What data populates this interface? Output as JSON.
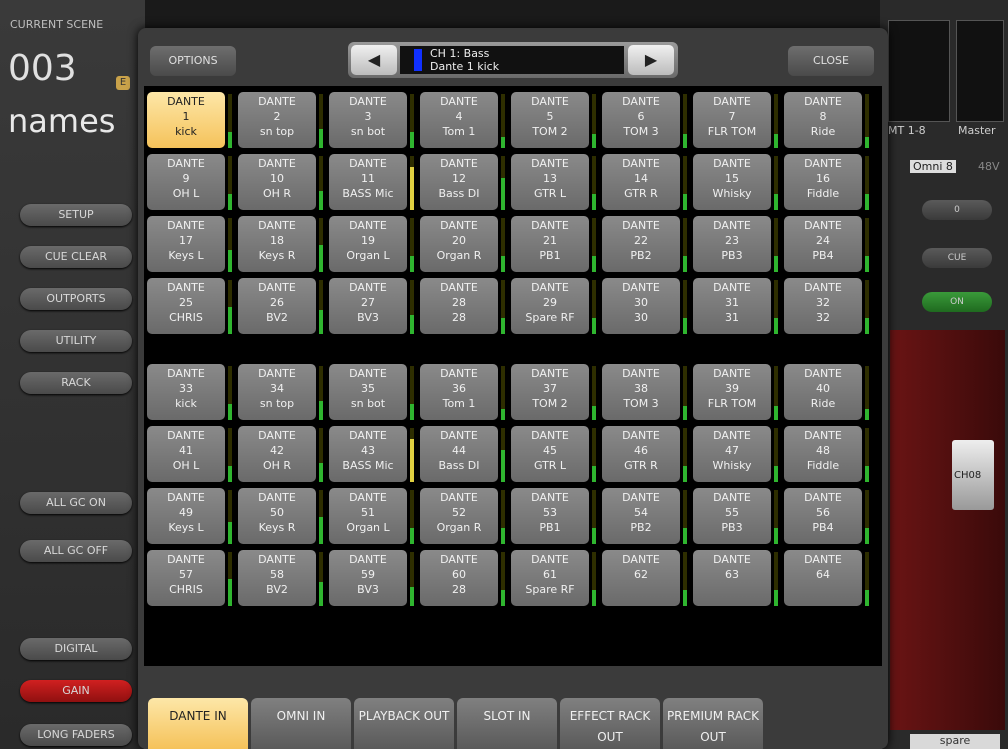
{
  "scene": {
    "label": "CURRENT SCENE",
    "number": "003",
    "edit_badge": "E",
    "name": "names"
  },
  "left_buttons": {
    "setup": "SETUP",
    "cue_clear": "CUE CLEAR",
    "outports": "OUTPORTS",
    "utility": "UTILITY",
    "rack": "RACK",
    "all_gc_on": "ALL GC ON",
    "all_gc_off": "ALL GC OFF",
    "digital": "DIGITAL",
    "gain": "GAIN",
    "long_faders": "LONG FADERS"
  },
  "right_panel": {
    "mt_label": "MT 1-8",
    "master_label": "Master",
    "omni_label": "Omni 8",
    "v48_label": "48V",
    "zero_btn": "0",
    "cue_btn": "CUE",
    "on_btn": "ON",
    "fader_label": "CH08",
    "spare_label": "spare"
  },
  "dialog": {
    "options": "OPTIONS",
    "close": "CLOSE",
    "prev_arrow": "◀",
    "next_arrow": "▶",
    "selector_line1": "CH 1: Bass",
    "selector_line2": "Dante 1 kick",
    "selector_color": "#1030ff",
    "ports": [
      {
        "type": "DANTE",
        "num": "1",
        "name": "kick",
        "selected": true,
        "level": 0.3
      },
      {
        "type": "DANTE",
        "num": "2",
        "name": "sn top",
        "level": 0.35
      },
      {
        "type": "DANTE",
        "num": "3",
        "name": "sn bot",
        "level": 0.3
      },
      {
        "type": "DANTE",
        "num": "4",
        "name": "Tom 1",
        "level": 0.2
      },
      {
        "type": "DANTE",
        "num": "5",
        "name": "TOM 2",
        "level": 0.25
      },
      {
        "type": "DANTE",
        "num": "6",
        "name": "TOM 3",
        "level": 0.25
      },
      {
        "type": "DANTE",
        "num": "7",
        "name": "FLR TOM",
        "level": 0.25
      },
      {
        "type": "DANTE",
        "num": "8",
        "name": "Ride",
        "level": 0.2
      },
      {
        "type": "DANTE",
        "num": "9",
        "name": "OH L",
        "level": 0.3
      },
      {
        "type": "DANTE",
        "num": "10",
        "name": "OH R",
        "level": 0.35
      },
      {
        "type": "DANTE",
        "num": "11",
        "name": "BASS Mic",
        "level": 0.8
      },
      {
        "type": "DANTE",
        "num": "12",
        "name": "Bass DI",
        "level": 0.6
      },
      {
        "type": "DANTE",
        "num": "13",
        "name": "GTR L",
        "level": 0.3
      },
      {
        "type": "DANTE",
        "num": "14",
        "name": "GTR R",
        "level": 0.3
      },
      {
        "type": "DANTE",
        "num": "15",
        "name": "Whisky",
        "level": 0.3
      },
      {
        "type": "DANTE",
        "num": "16",
        "name": "Fiddle",
        "level": 0.3
      },
      {
        "type": "DANTE",
        "num": "17",
        "name": "Keys L",
        "level": 0.4
      },
      {
        "type": "DANTE",
        "num": "18",
        "name": "Keys R",
        "level": 0.5
      },
      {
        "type": "DANTE",
        "num": "19",
        "name": "Organ L",
        "level": 0.3
      },
      {
        "type": "DANTE",
        "num": "20",
        "name": "Organ R",
        "level": 0.3
      },
      {
        "type": "DANTE",
        "num": "21",
        "name": "PB1",
        "level": 0.3
      },
      {
        "type": "DANTE",
        "num": "22",
        "name": "PB2",
        "level": 0.3
      },
      {
        "type": "DANTE",
        "num": "23",
        "name": "PB3",
        "level": 0.3
      },
      {
        "type": "DANTE",
        "num": "24",
        "name": "PB4",
        "level": 0.3
      },
      {
        "type": "DANTE",
        "num": "25",
        "name": "CHRIS",
        "level": 0.5
      },
      {
        "type": "DANTE",
        "num": "26",
        "name": "BV2",
        "level": 0.45
      },
      {
        "type": "DANTE",
        "num": "27",
        "name": "BV3",
        "level": 0.35
      },
      {
        "type": "DANTE",
        "num": "28",
        "name": "28",
        "level": 0.3
      },
      {
        "type": "DANTE",
        "num": "29",
        "name": "Spare RF",
        "level": 0.3
      },
      {
        "type": "DANTE",
        "num": "30",
        "name": "30",
        "level": 0.3
      },
      {
        "type": "DANTE",
        "num": "31",
        "name": "31",
        "level": 0.3
      },
      {
        "type": "DANTE",
        "num": "32",
        "name": "32",
        "level": 0.3
      },
      {
        "type": "DANTE",
        "num": "33",
        "name": "kick",
        "level": 0.3
      },
      {
        "type": "DANTE",
        "num": "34",
        "name": "sn top",
        "level": 0.35
      },
      {
        "type": "DANTE",
        "num": "35",
        "name": "sn bot",
        "level": 0.3
      },
      {
        "type": "DANTE",
        "num": "36",
        "name": "Tom 1",
        "level": 0.2
      },
      {
        "type": "DANTE",
        "num": "37",
        "name": "TOM 2",
        "level": 0.25
      },
      {
        "type": "DANTE",
        "num": "38",
        "name": "TOM 3",
        "level": 0.25
      },
      {
        "type": "DANTE",
        "num": "39",
        "name": "FLR TOM",
        "level": 0.25
      },
      {
        "type": "DANTE",
        "num": "40",
        "name": "Ride",
        "level": 0.2
      },
      {
        "type": "DANTE",
        "num": "41",
        "name": "OH L",
        "level": 0.3
      },
      {
        "type": "DANTE",
        "num": "42",
        "name": "OH R",
        "level": 0.35
      },
      {
        "type": "DANTE",
        "num": "43",
        "name": "BASS Mic",
        "level": 0.8
      },
      {
        "type": "DANTE",
        "num": "44",
        "name": "Bass DI",
        "level": 0.6
      },
      {
        "type": "DANTE",
        "num": "45",
        "name": "GTR L",
        "level": 0.3
      },
      {
        "type": "DANTE",
        "num": "46",
        "name": "GTR R",
        "level": 0.3
      },
      {
        "type": "DANTE",
        "num": "47",
        "name": "Whisky",
        "level": 0.3
      },
      {
        "type": "DANTE",
        "num": "48",
        "name": "Fiddle",
        "level": 0.3
      },
      {
        "type": "DANTE",
        "num": "49",
        "name": "Keys L",
        "level": 0.4
      },
      {
        "type": "DANTE",
        "num": "50",
        "name": "Keys R",
        "level": 0.5
      },
      {
        "type": "DANTE",
        "num": "51",
        "name": "Organ L",
        "level": 0.3
      },
      {
        "type": "DANTE",
        "num": "52",
        "name": "Organ R",
        "level": 0.3
      },
      {
        "type": "DANTE",
        "num": "53",
        "name": "PB1",
        "level": 0.3
      },
      {
        "type": "DANTE",
        "num": "54",
        "name": "PB2",
        "level": 0.3
      },
      {
        "type": "DANTE",
        "num": "55",
        "name": "PB3",
        "level": 0.3
      },
      {
        "type": "DANTE",
        "num": "56",
        "name": "PB4",
        "level": 0.3
      },
      {
        "type": "DANTE",
        "num": "57",
        "name": "CHRIS",
        "level": 0.5
      },
      {
        "type": "DANTE",
        "num": "58",
        "name": "BV2",
        "level": 0.45
      },
      {
        "type": "DANTE",
        "num": "59",
        "name": "BV3",
        "level": 0.35
      },
      {
        "type": "DANTE",
        "num": "60",
        "name": "28",
        "level": 0.3
      },
      {
        "type": "DANTE",
        "num": "61",
        "name": "Spare RF",
        "level": 0.3
      },
      {
        "type": "DANTE",
        "num": "62",
        "name": "",
        "level": 0.3
      },
      {
        "type": "DANTE",
        "num": "63",
        "name": "",
        "level": 0.3
      },
      {
        "type": "DANTE",
        "num": "64",
        "name": "",
        "level": 0.3
      }
    ],
    "tabs": [
      {
        "label": "DANTE IN",
        "active": true
      },
      {
        "label": "OMNI IN"
      },
      {
        "label": "PLAYBACK OUT"
      },
      {
        "label": "SLOT IN"
      },
      {
        "label": "EFFECT RACK OUT"
      },
      {
        "label": "PREMIUM RACK OUT"
      }
    ]
  }
}
